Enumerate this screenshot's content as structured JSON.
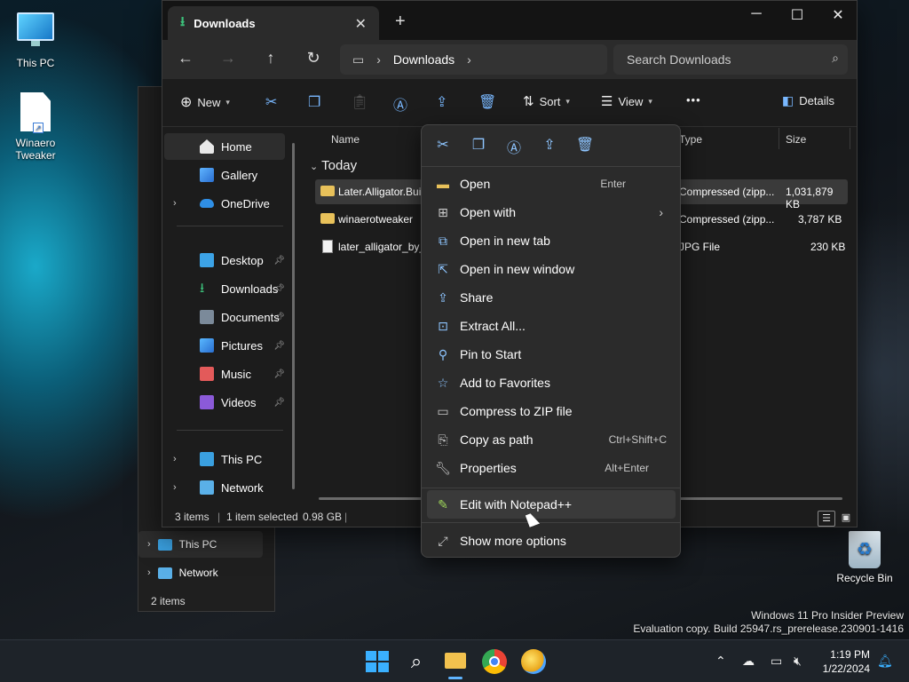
{
  "desktop": {
    "icons": [
      {
        "label": "This PC",
        "icon": "this-pc-icon"
      },
      {
        "label": "Winaero Tweaker",
        "icon": "winaero-tweaker-icon"
      },
      {
        "label": "Recycle Bin",
        "icon": "recycle-bin-icon"
      }
    ],
    "watermark": {
      "line1": "Windows 11 Pro Insider Preview",
      "line2": "Evaluation copy. Build 25947.rs_prerelease.230901-1416"
    }
  },
  "back_window": {
    "nav": [
      {
        "label": "This PC",
        "icon": "this-pc-icon"
      },
      {
        "label": "Network",
        "icon": "network-icon"
      }
    ],
    "status": "2 items"
  },
  "explorer": {
    "tab_title": "Downloads",
    "breadcrumb": "Downloads",
    "search_placeholder": "Search Downloads",
    "toolbar": {
      "new_label": "New",
      "sort_label": "Sort",
      "view_label": "View",
      "more_label": "•••",
      "details_label": "Details"
    },
    "nav": {
      "home": "Home",
      "gallery": "Gallery",
      "onedrive": "OneDrive",
      "desktop": "Desktop",
      "downloads": "Downloads",
      "documents": "Documents",
      "pictures": "Pictures",
      "music": "Music",
      "videos": "Videos",
      "this_pc": "This PC",
      "network": "Network"
    },
    "columns": {
      "name": "Name",
      "type": "Type",
      "size": "Size"
    },
    "group_label": "Today",
    "files": [
      {
        "name": "Later.Alligator.Buil",
        "type": "Compressed (zipp...",
        "size": "1,031,879 KB",
        "selected": true
      },
      {
        "name": "winaerotweaker",
        "type": "Compressed (zipp...",
        "size": "3,787 KB",
        "selected": false
      },
      {
        "name": "later_alligator_by_",
        "type": "JPG File",
        "size": "230 KB",
        "selected": false
      }
    ],
    "status": {
      "items": "3 items",
      "selected": "1 item selected",
      "size": "0.98 GB"
    }
  },
  "context_menu": {
    "quick_actions": [
      "cut-icon",
      "copy-icon",
      "rename-icon",
      "share-icon",
      "delete-icon"
    ],
    "items": [
      {
        "label": "Open",
        "shortcut": "Enter"
      },
      {
        "label": "Open with",
        "shortcut": ""
      },
      {
        "label": "Open in new tab",
        "shortcut": ""
      },
      {
        "label": "Open in new window",
        "shortcut": ""
      },
      {
        "label": "Share",
        "shortcut": ""
      },
      {
        "label": "Extract All...",
        "shortcut": ""
      },
      {
        "label": "Pin to Start",
        "shortcut": ""
      },
      {
        "label": "Add to Favorites",
        "shortcut": ""
      },
      {
        "label": "Compress to ZIP file",
        "shortcut": ""
      },
      {
        "label": "Copy as path",
        "shortcut": "Ctrl+Shift+C"
      },
      {
        "label": "Properties",
        "shortcut": "Alt+Enter"
      },
      {
        "label": "Edit with Notepad++",
        "shortcut": ""
      },
      {
        "label": "Show more options",
        "shortcut": ""
      }
    ]
  },
  "taskbar": {
    "time": "1:19 PM",
    "date": "1/22/2024"
  }
}
